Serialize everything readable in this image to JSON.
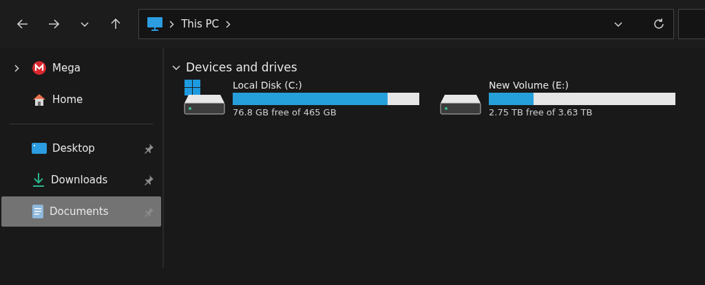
{
  "address_bar": {
    "segments": [
      "This PC"
    ]
  },
  "sidebar": {
    "groups": [
      [
        {
          "label": "Mega",
          "kind": "mega",
          "expandable": true,
          "pinned": false,
          "selected": false
        },
        {
          "label": "Home",
          "kind": "home",
          "expandable": false,
          "pinned": false,
          "selected": false
        }
      ],
      [
        {
          "label": "Desktop",
          "kind": "desktop",
          "expandable": false,
          "pinned": true,
          "selected": false
        },
        {
          "label": "Downloads",
          "kind": "downloads",
          "expandable": false,
          "pinned": true,
          "selected": false
        },
        {
          "label": "Documents",
          "kind": "documents",
          "expandable": false,
          "pinned": true,
          "selected": true
        }
      ]
    ]
  },
  "section": {
    "title": "Devices and drives",
    "expanded": true,
    "drives": [
      {
        "name": "Local Disk (C:)",
        "system": true,
        "level": 0.83,
        "reading": "76.8 GB free of 465 GB"
      },
      {
        "name": "New Volume (E:)",
        "system": false,
        "level": 0.24,
        "reading": "2.75 TB free of 3.63 TB"
      }
    ]
  }
}
